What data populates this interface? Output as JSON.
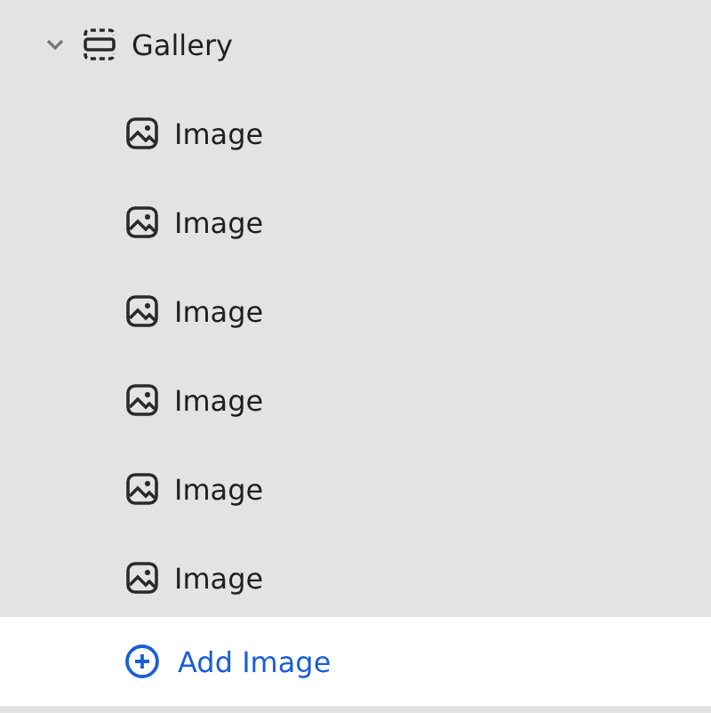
{
  "tree": {
    "label": "Gallery",
    "expanded": true,
    "children": [
      {
        "label": "Image"
      },
      {
        "label": "Image"
      },
      {
        "label": "Image"
      },
      {
        "label": "Image"
      },
      {
        "label": "Image"
      },
      {
        "label": "Image"
      }
    ]
  },
  "add_button": {
    "label": "Add Image"
  }
}
